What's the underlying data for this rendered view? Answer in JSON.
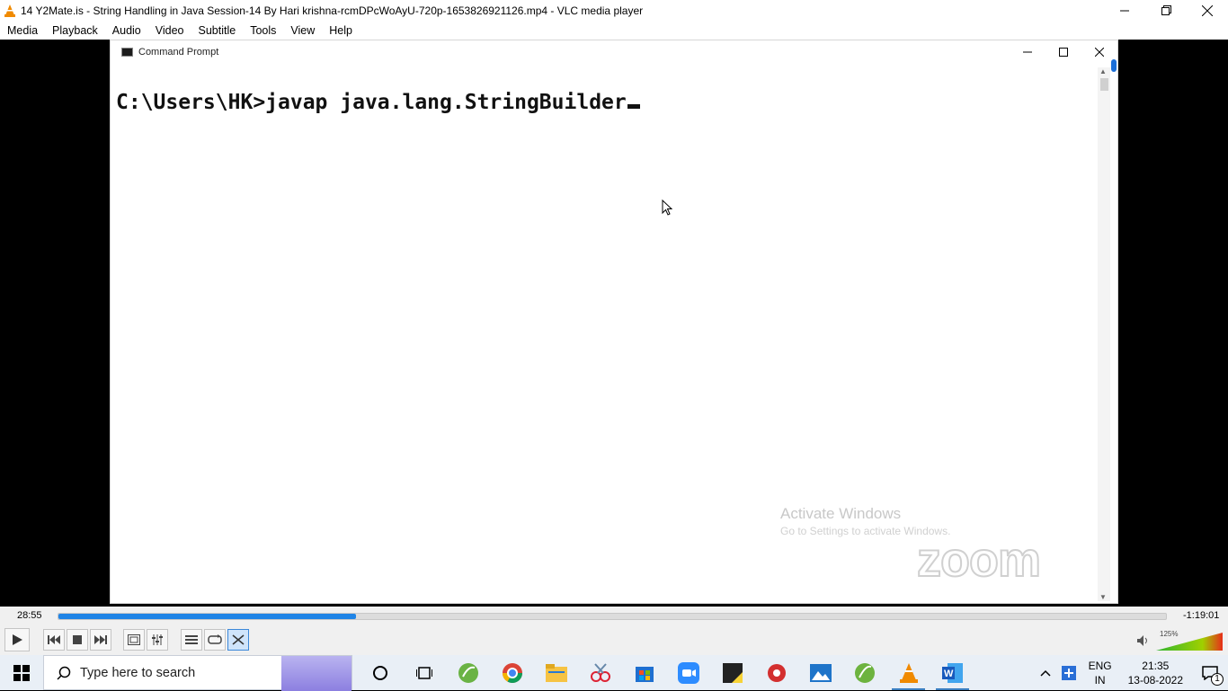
{
  "vlc": {
    "title": "14 Y2Mate.is - String Handling in Java  Session-14  By Hari krishna-rcmDPcWoAyU-720p-1653826921126.mp4 - VLC media player",
    "menu": [
      "Media",
      "Playback",
      "Audio",
      "Video",
      "Subtitle",
      "Tools",
      "View",
      "Help"
    ],
    "elapsed": "28:55",
    "remaining": "-1:19:01",
    "progress": 0.269,
    "volume_percent": "125%"
  },
  "cmd": {
    "title": "Command Prompt",
    "line": "C:\\Users\\HK>javap java.lang.StringBuilder"
  },
  "watermark": {
    "line1": "Activate Windows",
    "line2": "Go to Settings to activate Windows.",
    "logo": "zoom"
  },
  "taskbar": {
    "search_placeholder": "Type here to search",
    "lang_top": "ENG",
    "lang_bottom": "IN",
    "time": "21:35",
    "date": "13-08-2022",
    "notification_count": "1"
  },
  "colors": {
    "accent": "#1f84e6",
    "vlc_orange": "#f08a00"
  }
}
